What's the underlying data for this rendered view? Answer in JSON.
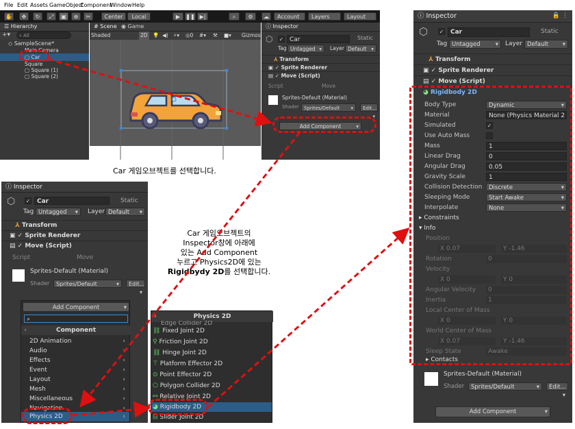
{
  "menubar": {
    "items": [
      "File",
      "Edit",
      "Assets",
      "GameObject",
      "Component",
      "Window",
      "Help"
    ]
  },
  "toolbar": {
    "center": "Center",
    "local": "Local",
    "account": "Account",
    "layers": "Layers",
    "layout": "Layout"
  },
  "hierarchy": {
    "tab": "Hierarchy",
    "search": "All",
    "scene": "SampleScene*",
    "items": [
      "Main Camera",
      "Car",
      "Square",
      "Square (1)",
      "Square (2)"
    ]
  },
  "scene_view": {
    "tab_scene": "Scene",
    "tab_game": "Game",
    "shaded": "Shaded",
    "mode2d": "2D",
    "gizmos": "Gizmos"
  },
  "inspector_small": {
    "tab": "Inspector",
    "object": "Car",
    "static": "Static",
    "tag_label": "Tag",
    "tag": "Untagged",
    "layer_label": "Layer",
    "layer": "Default",
    "components": [
      "Transform",
      "Sprite Renderer",
      "Move (Script)"
    ],
    "script_label": "Script",
    "script_val": "Move",
    "material": "Sprites-Default (Material)",
    "shader_label": "Shader",
    "shader": "Sprites/Default",
    "edit": "Edit...",
    "add_component": "Add Component"
  },
  "caption1": "Car 게임오브젝트를 선택합니다.",
  "caption2_lines": [
    "Car 게임오브젝트의",
    "Inspector창에 아래에",
    "있는 Add Component",
    "누르고 Physics2D에 있는"
  ],
  "caption2_bold": "Rigidbydy 2D",
  "caption2_tail": "를 선택합니다.",
  "inspector_mid": {
    "tab": "Inspector",
    "object": "Car",
    "static": "Static",
    "tag_label": "Tag",
    "tag": "Untagged",
    "layer_label": "Layer",
    "layer": "Default",
    "components": [
      "Transform",
      "Sprite Renderer",
      "Move (Script)"
    ],
    "script_label": "Script",
    "script_val": "Move",
    "material": "Sprites-Default (Material)",
    "shader_label": "Shader",
    "shader": "Sprites/Default",
    "edit": "Edit..."
  },
  "add_component_menu": {
    "button": "Add Component",
    "title": "Component",
    "items": [
      "2D Animation",
      "Audio",
      "Effects",
      "Event",
      "Layout",
      "Mesh",
      "Miscellaneous",
      "Navigation",
      "Physics 2D"
    ]
  },
  "physics2d_menu": {
    "title": "Physics 2D",
    "items": [
      "Edge Collider 2D",
      "Fixed Joint 2D",
      "Friction Joint 2D",
      "Hinge Joint 2D",
      "Platform Effector 2D",
      "Point Effector 2D",
      "Polygon Collider 2D",
      "Relative Joint 2D",
      "Rigidbody 2D",
      "Slider Joint 2D"
    ]
  },
  "inspector_big": {
    "tab": "Inspector",
    "object": "Car",
    "static": "Static",
    "tag_label": "Tag",
    "tag": "Untagged",
    "layer_label": "Layer",
    "layer": "Default",
    "components": [
      "Transform",
      "Sprite Renderer",
      "Move (Script)"
    ],
    "rigidbody_title": "Rigidbody 2D",
    "props": [
      {
        "label": "Body Type",
        "value": "Dynamic",
        "kind": "dd"
      },
      {
        "label": "Material",
        "value": "None (Physics Material 2",
        "kind": "obj"
      },
      {
        "label": "Simulated",
        "value": "✓",
        "kind": "chk"
      },
      {
        "label": "Use Auto Mass",
        "value": "",
        "kind": "chk"
      },
      {
        "label": "Mass",
        "value": "1",
        "kind": "field"
      },
      {
        "label": "Linear Drag",
        "value": "0",
        "kind": "field"
      },
      {
        "label": "Angular Drag",
        "value": "0.05",
        "kind": "field"
      },
      {
        "label": "Gravity Scale",
        "value": "1",
        "kind": "field"
      },
      {
        "label": "Collision Detection",
        "value": "Discrete",
        "kind": "dd"
      },
      {
        "label": "Sleeping Mode",
        "value": "Start Awake",
        "kind": "dd"
      },
      {
        "label": "Interpolate",
        "value": "None",
        "kind": "dd"
      }
    ],
    "constraints": "Constraints",
    "info": "Info",
    "info_rows": [
      {
        "label": "Position",
        "value": ""
      },
      {
        "label": "",
        "value": "X  0.07",
        "value2": "Y  -1.46"
      },
      {
        "label": "Rotation",
        "value": "0"
      },
      {
        "label": "Velocity",
        "value": ""
      },
      {
        "label": "",
        "value": "X  0",
        "value2": "Y  0"
      },
      {
        "label": "Angular Velocity",
        "value": "0"
      },
      {
        "label": "Inertia",
        "value": "1"
      },
      {
        "label": "Local Center of Mass",
        "value": ""
      },
      {
        "label": "",
        "value": "X  0",
        "value2": "Y  0"
      },
      {
        "label": "World Center of Mass",
        "value": ""
      },
      {
        "label": "",
        "value": "X  0.07",
        "value2": "Y  -1.46"
      },
      {
        "label": "Sleep State",
        "value": "Awake"
      }
    ],
    "contacts": "Contacts",
    "material": "Sprites-Default (Material)",
    "shader_label": "Shader",
    "shader": "Sprites/Default",
    "edit": "Edit...",
    "add_component": "Add Component"
  }
}
